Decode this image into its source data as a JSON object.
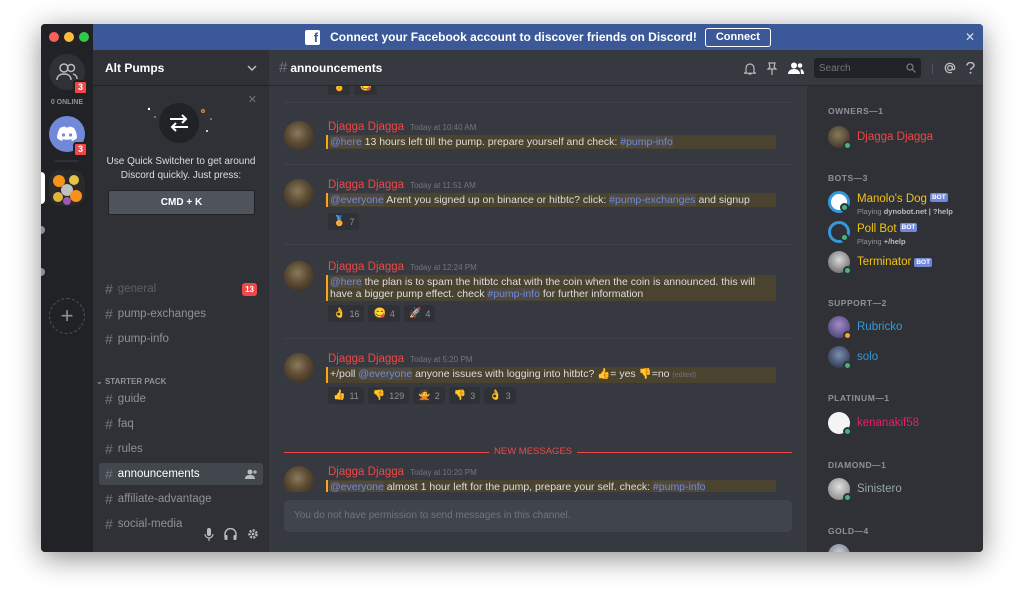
{
  "banner": {
    "text": "Connect your Facebook account to discover friends on Discord!",
    "connect_label": "Connect",
    "close_symbol": "✕"
  },
  "guilds": {
    "friends_badge": "3",
    "online_label": "0 ONLINE",
    "discord_badge": "3",
    "add_symbol": "+"
  },
  "server": {
    "name": "Alt Pumps",
    "chevron": "⌄"
  },
  "quick_switcher": {
    "text": "Use Quick Switcher to get around Discord quickly. Just press:",
    "shortcut": "CMD + K",
    "close_symbol": "✕"
  },
  "channels": [
    {
      "name": "general",
      "badge": "13"
    },
    {
      "name": "pump-exchanges"
    },
    {
      "name": "pump-info"
    }
  ],
  "category": {
    "name": "STARTER PACK",
    "arrow": "⌄"
  },
  "category_channels": [
    "guide",
    "faq",
    "rules",
    "announcements",
    "affiliate-advantage",
    "social-media"
  ],
  "channel_header": {
    "hash": "#",
    "name": "announcements",
    "search_placeholder": "Search"
  },
  "messages": [
    {
      "author": "Djagga Djagga",
      "timestamp": "Today at 10:40 AM",
      "mention": "@here",
      "text": " 13 hours left till the pump. prepare yourself and check: ",
      "channel_link": "#pump-info"
    },
    {
      "author": "Djagga Djagga",
      "timestamp": "Today at 11:51 AM",
      "mention": "@everyone",
      "text": " Arent you signed up on binance or hitbtc? click: ",
      "channel_link": "#pump-exchanges",
      "text_after": " and signup",
      "reactions": [
        {
          "emoji": "🏅",
          "count": "7"
        }
      ]
    },
    {
      "author": "Djagga Djagga",
      "timestamp": "Today at 12:24 PM",
      "mention": "@here",
      "text": " the plan is to spam the hitbtc chat with the coin when the coin is announced. this will have a bigger pump effect. check ",
      "channel_link": "#pump-info",
      "text_after": " for further information",
      "reactions": [
        {
          "emoji": "👌",
          "count": "16"
        },
        {
          "emoji": "😋",
          "count": "4"
        },
        {
          "emoji": "🚀",
          "count": "4"
        }
      ]
    },
    {
      "author": "Djagga Djagga",
      "timestamp": "Today at 5:20 PM",
      "prefix": "+/poll ",
      "mention": "@everyone",
      "text": " anyone issues with logging into hitbtc? ",
      "yes_emoji": "👍",
      "yes_text": "= yes ",
      "no_emoji": "👎",
      "no_text": "=no ",
      "edited": "(edited)",
      "reactions": [
        {
          "emoji": "👍",
          "count": "11"
        },
        {
          "emoji": "👎",
          "count": "129"
        },
        {
          "emoji": "🙅",
          "count": "2"
        },
        {
          "emoji": "👎",
          "count": "3"
        },
        {
          "emoji": "👌",
          "count": "3"
        }
      ]
    },
    {
      "author": "Djagga Djagga",
      "timestamp": "Today at 10:20 PM",
      "mention": "@everyone",
      "text": " almost 1 hour left for the pump, prepare your self. check: ",
      "channel_link": "#pump-info"
    }
  ],
  "new_messages_label": "NEW MESSAGES",
  "input_placeholder": "You do not have permission to send messages in this channel.",
  "members": {
    "owners_title": "OWNERS—1",
    "owners": [
      {
        "name": "Djagga Djagga",
        "color": "#f04747"
      }
    ],
    "bots_title": "BOTS—3",
    "bots": [
      {
        "name": "Manolo's Dog",
        "badge": "BOT",
        "playing_label": "Playing",
        "playing": "dynobot.net | ?help",
        "color": "#f1c40f"
      },
      {
        "name": "Poll Bot",
        "badge": "BOT",
        "playing_label": "Playing",
        "playing": "+/help",
        "color": "#f1c40f"
      },
      {
        "name": "Terminator",
        "badge": "BOT",
        "color": "#f1c40f"
      }
    ],
    "support_title": "SUPPORT—2",
    "support": [
      {
        "name": "Rubricko",
        "color": "#3498db"
      },
      {
        "name": "solo",
        "color": "#3498db"
      }
    ],
    "platinum_title": "PLATINUM—1",
    "platinum": [
      {
        "name": "kenanakif58",
        "color": "#e91e63"
      }
    ],
    "diamond_title": "DIAMOND—1",
    "diamond": [
      {
        "name": "Sinistero",
        "color": "#95a5a6"
      }
    ],
    "gold_title": "GOLD—4"
  }
}
